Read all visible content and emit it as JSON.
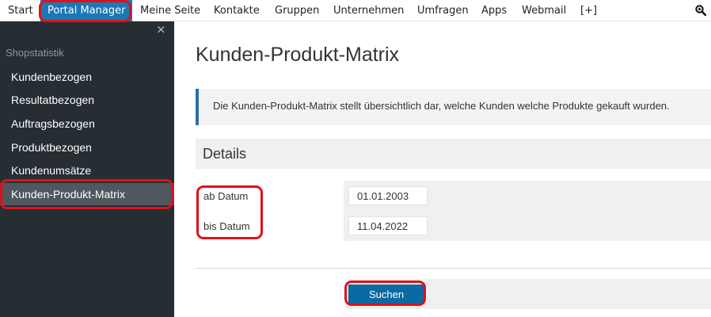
{
  "topnav": {
    "items": [
      {
        "label": "Start"
      },
      {
        "label": "Portal Manager",
        "active": true
      },
      {
        "label": "Meine Seite"
      },
      {
        "label": "Kontakte"
      },
      {
        "label": "Gruppen"
      },
      {
        "label": "Unternehmen"
      },
      {
        "label": "Umfragen"
      },
      {
        "label": "Apps"
      },
      {
        "label": "Webmail"
      },
      {
        "label": "[+]"
      }
    ],
    "search_icon": "search-zoom-icon"
  },
  "sidebar": {
    "close_symbol": "×",
    "heading": "Shopstatistik",
    "items": [
      {
        "label": "Kundenbezogen"
      },
      {
        "label": "Resultatbezogen"
      },
      {
        "label": "Auftragsbezogen"
      },
      {
        "label": "Produktbezogen"
      },
      {
        "label": "Kundenumsätze"
      },
      {
        "label": "Kunden-Produkt-Matrix",
        "active": true
      }
    ]
  },
  "main": {
    "title": "Kunden-Produkt-Matrix",
    "info": "Die Kunden-Produkt-Matrix stellt übersichtlich dar, welche Kunden welche Produkte gekauft wurden.",
    "details_title": "Details",
    "form": {
      "from_label": "ab Datum",
      "from_value": "01.01.2003",
      "to_label": "bis Datum",
      "to_value": "11.04.2022"
    },
    "search_button": "Suchen"
  },
  "colors": {
    "nav_active": "#1b78b8",
    "sidebar_bg": "#262d33",
    "sidebar_active": "#50575e",
    "info_accent": "#2a6fa8",
    "button": "#0a6aa1",
    "annotation": "#e0101a"
  }
}
